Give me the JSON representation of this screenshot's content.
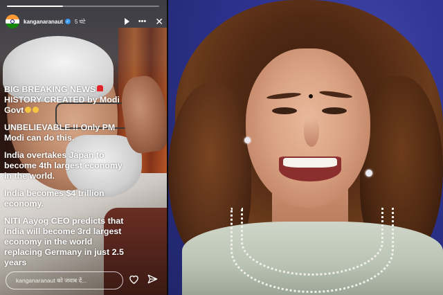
{
  "story": {
    "username": "kanganaranaut",
    "time_ago": "5 घंटे",
    "progress": 0.37,
    "lines": [
      "BIG BREAKING NEWS",
      "HISTORY CREATED by Modi Govt",
      "UNBELIEVABLE !! Only PM Modi can do this.",
      "India overtakes Japan to become 4th largest economy in the world.",
      "India becomes $4 trillion economy.",
      "NITI Aayog CEO predicts that India will become 3rd largest economy in the world replacing Germany in just 2.5 years"
    ],
    "reply_placeholder": "kanganaranaut को जवाब दें..."
  },
  "icons": {
    "avatar": "india-flag-avatar",
    "verified": "verified-badge-icon",
    "play": "play-icon",
    "more": "more-options-icon",
    "close": "close-icon",
    "heart": "heart-icon",
    "send": "send-icon"
  },
  "colors": {
    "verified_blue": "#3897f0",
    "portrait_bg": "#2e3390"
  }
}
